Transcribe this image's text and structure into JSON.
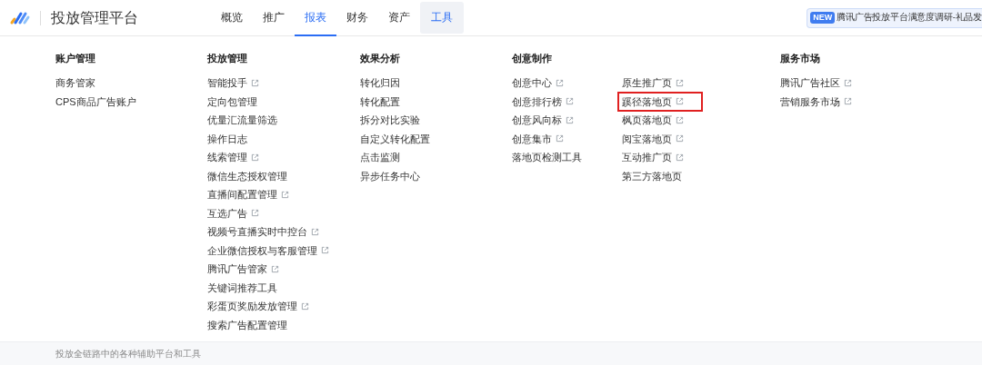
{
  "header": {
    "title": "投放管理平台",
    "nav": [
      {
        "label": "概览",
        "selected": false,
        "expanded": false
      },
      {
        "label": "推广",
        "selected": false,
        "expanded": false
      },
      {
        "label": "报表",
        "selected": true,
        "expanded": false
      },
      {
        "label": "财务",
        "selected": false,
        "expanded": false
      },
      {
        "label": "资产",
        "selected": false,
        "expanded": false
      },
      {
        "label": "工具",
        "selected": false,
        "expanded": true
      }
    ],
    "notice": {
      "badge": "NEW",
      "text": "腾讯广告投放平台满意度调研-礼品发"
    }
  },
  "menu": {
    "columns": [
      {
        "heading": "账户管理",
        "groups": [
          [
            {
              "label": "商务管家",
              "external": false,
              "highlighted": false
            },
            {
              "label": "CPS商品广告账户",
              "external": false,
              "highlighted": false
            }
          ]
        ]
      },
      {
        "heading": "投放管理",
        "groups": [
          [
            {
              "label": "智能投手",
              "external": true,
              "highlighted": false
            },
            {
              "label": "定向包管理",
              "external": false,
              "highlighted": false
            },
            {
              "label": "优量汇流量筛选",
              "external": false,
              "highlighted": false
            },
            {
              "label": "操作日志",
              "external": false,
              "highlighted": false
            },
            {
              "label": "线索管理",
              "external": true,
              "highlighted": false
            },
            {
              "label": "微信生态授权管理",
              "external": false,
              "highlighted": false
            },
            {
              "label": "直播间配置管理",
              "external": true,
              "highlighted": false
            },
            {
              "label": "互选广告",
              "external": true,
              "highlighted": false
            },
            {
              "label": "视频号直播实时中控台",
              "external": true,
              "highlighted": false
            },
            {
              "label": "企业微信授权与客服管理",
              "external": true,
              "highlighted": false
            },
            {
              "label": "腾讯广告管家",
              "external": true,
              "highlighted": false
            },
            {
              "label": "关键词推荐工具",
              "external": false,
              "highlighted": false
            },
            {
              "label": "彩蛋页奖励发放管理",
              "external": true,
              "highlighted": false
            },
            {
              "label": "搜索广告配置管理",
              "external": false,
              "highlighted": false
            }
          ]
        ]
      },
      {
        "heading": "效果分析",
        "groups": [
          [
            {
              "label": "转化归因",
              "external": false,
              "highlighted": false
            },
            {
              "label": "转化配置",
              "external": false,
              "highlighted": false
            },
            {
              "label": "拆分对比实验",
              "external": false,
              "highlighted": false
            },
            {
              "label": "自定义转化配置",
              "external": false,
              "highlighted": false
            },
            {
              "label": "点击监测",
              "external": false,
              "highlighted": false
            },
            {
              "label": "异步任务中心",
              "external": false,
              "highlighted": false
            }
          ]
        ]
      },
      {
        "heading": "创意制作",
        "groups": [
          [
            {
              "label": "创意中心",
              "external": true,
              "highlighted": false
            },
            {
              "label": "创意排行榜",
              "external": true,
              "highlighted": false
            },
            {
              "label": "创意风向标",
              "external": true,
              "highlighted": false
            },
            {
              "label": "创意集市",
              "external": true,
              "highlighted": false
            },
            {
              "label": "落地页检测工具",
              "external": false,
              "highlighted": false
            }
          ],
          [
            {
              "label": "原生推广页",
              "external": true,
              "highlighted": false
            },
            {
              "label": "蹊径落地页",
              "external": true,
              "highlighted": true
            },
            {
              "label": "枫页落地页",
              "external": true,
              "highlighted": false
            },
            {
              "label": "阅宝落地页",
              "external": true,
              "highlighted": false
            },
            {
              "label": "互动推广页",
              "external": true,
              "highlighted": false
            },
            {
              "label": "第三方落地页",
              "external": false,
              "highlighted": false
            }
          ]
        ]
      },
      {
        "heading": "服务市场",
        "groups": [
          [
            {
              "label": "腾讯广告社区",
              "external": true,
              "highlighted": false
            },
            {
              "label": "营销服务市场",
              "external": true,
              "highlighted": false
            }
          ]
        ]
      }
    ]
  },
  "footer": {
    "text": "投放全链路中的各种辅助平台和工具"
  }
}
